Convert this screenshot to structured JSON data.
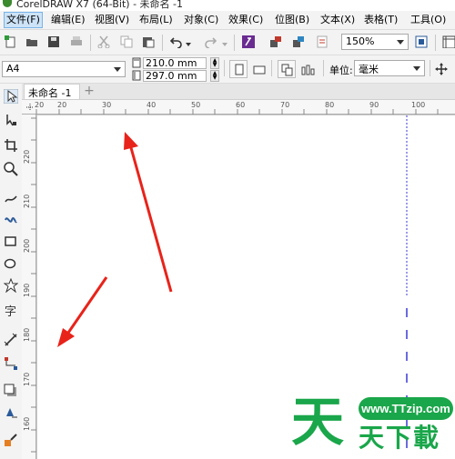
{
  "window": {
    "title": "CorelDRAW X7 (64-Bit) - 未命名 -1"
  },
  "menu": [
    {
      "label": "文件(F)",
      "active": true
    },
    {
      "label": "编辑(E)"
    },
    {
      "label": "视图(V)"
    },
    {
      "label": "布局(L)"
    },
    {
      "label": "对象(C)"
    },
    {
      "label": "效果(C)"
    },
    {
      "label": "位图(B)"
    },
    {
      "label": "文本(X)"
    },
    {
      "label": "表格(T)"
    },
    {
      "label": "工具(O)"
    }
  ],
  "toolbar": {
    "zoom_value": "150%"
  },
  "property_bar": {
    "page_size": "A4",
    "width": "210.0 mm",
    "height": "297.0 mm",
    "units_label": "单位:",
    "units_value": "毫米"
  },
  "document": {
    "tab_label": "未命名 -1",
    "add_tab": "+"
  },
  "ruler": {
    "h_labels": [
      "20",
      "20",
      "30",
      "40",
      "50",
      "60",
      "70",
      "80",
      "90",
      "100"
    ],
    "v_labels": [
      "220",
      "210",
      "200",
      "190",
      "180",
      "170",
      "160"
    ]
  },
  "watermark": {
    "url": "www.TTzip.com",
    "big_char": "天",
    "small_text": "天下載"
  },
  "colors": {
    "accent": "#e8231a",
    "watermark_green": "#1aa64a",
    "guide_blue": "#3a3ad6"
  }
}
